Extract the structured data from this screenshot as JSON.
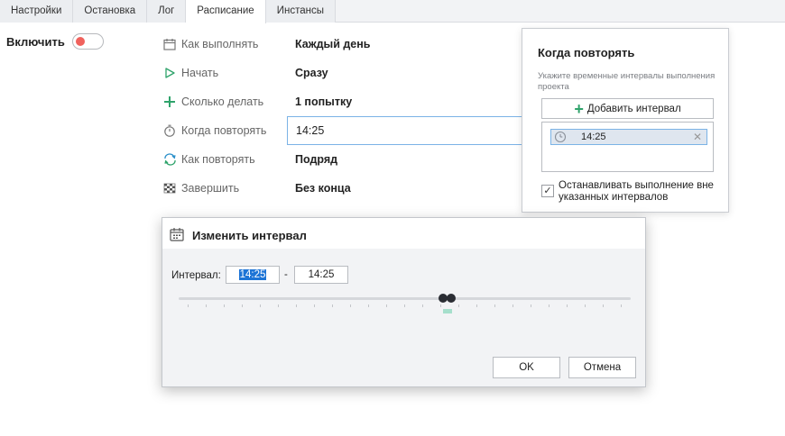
{
  "tabs": [
    "Настройки",
    "Остановка",
    "Лог",
    "Расписание",
    "Инстансы"
  ],
  "active_tab": "Расписание",
  "enable": {
    "label": "Включить",
    "state": "off",
    "knob_color": "#f0625d"
  },
  "rows": [
    {
      "label": "Как выполнять",
      "value": "Каждый день",
      "icon": "calendar-icon"
    },
    {
      "label": "Начать",
      "value": "Сразу",
      "icon": "play-icon"
    },
    {
      "label": "Сколько делать",
      "value": "1 попытку",
      "icon": "plus-icon"
    },
    {
      "label": "Когда повторять",
      "value": "14:25",
      "icon": "stopwatch-icon"
    },
    {
      "label": "Как повторять",
      "value": "Подряд",
      "icon": "repeat-icon"
    },
    {
      "label": "Завершить",
      "value": "Без конца",
      "icon": "finish-flag-icon"
    }
  ],
  "when_panel": {
    "title": "Когда повторять",
    "subtitle": "Укажите временные интервалы выполнения проекта",
    "add_button": "Добавить интервал",
    "intervals": [
      "14:25"
    ],
    "stop_checkbox_label": "Останавливать выполнение вне указанных интервалов",
    "stop_checked": true
  },
  "dialog": {
    "title": "Изменить интервал",
    "interval_label": "Интервал:",
    "from": "14:25",
    "separator": "-",
    "to": "14:25",
    "ok": "OK",
    "cancel": "Отмена"
  },
  "colors": {
    "accent_green": "#2fa36b",
    "selection_blue": "#1d74d6",
    "highlight_border": "#7bb3e6"
  }
}
